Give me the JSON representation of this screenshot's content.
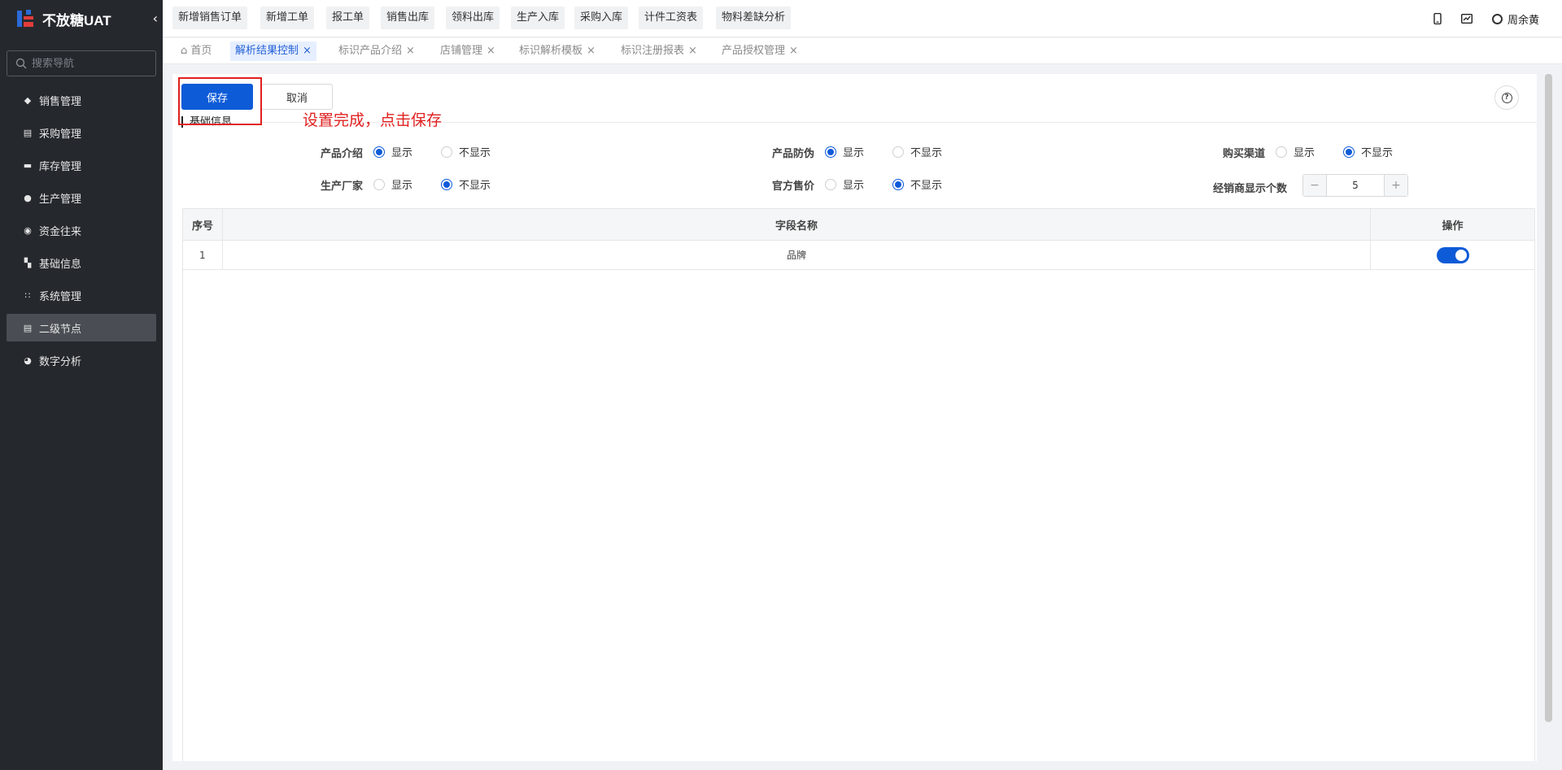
{
  "brand": {
    "title": "不放糖UAT"
  },
  "sidebar": {
    "search_placeholder": "搜索导航",
    "items": [
      {
        "label": "销售管理",
        "icon": "tag-icon"
      },
      {
        "label": "采购管理",
        "icon": "cart-icon"
      },
      {
        "label": "库存管理",
        "icon": "box-icon"
      },
      {
        "label": "生产管理",
        "icon": "production-icon"
      },
      {
        "label": "资金往来",
        "icon": "money-icon"
      },
      {
        "label": "基础信息",
        "icon": "info-icon"
      },
      {
        "label": "系统管理",
        "icon": "grid-icon"
      },
      {
        "label": "二级节点",
        "icon": "document-icon",
        "active": true
      },
      {
        "label": "数字分析",
        "icon": "pie-chart-icon"
      }
    ]
  },
  "quick_buttons": [
    "新增销售订单",
    "新增工单",
    "报工单",
    "销售出库",
    "领料出库",
    "生产入库",
    "采购入库",
    "计件工资表",
    "物料差缺分析"
  ],
  "user": {
    "name": "周余黄"
  },
  "tabs": [
    {
      "label": "首页"
    },
    {
      "label": "解析结果控制",
      "active": true
    },
    {
      "label": "标识产品介绍"
    },
    {
      "label": "店铺管理"
    },
    {
      "label": "标识解析模板"
    },
    {
      "label": "标识注册报表"
    },
    {
      "label": "产品授权管理"
    }
  ],
  "toolbar": {
    "save_label": "保存",
    "cancel_label": "取消",
    "help_label": "?"
  },
  "annotation": "设置完成，点击保存",
  "section_title": "基础信息",
  "fields": {
    "product_intro": {
      "label": "产品介绍",
      "show": "显示",
      "hide": "不显示",
      "value": "show"
    },
    "anti_fake": {
      "label": "产品防伪",
      "show": "显示",
      "hide": "不显示",
      "value": "show"
    },
    "channel": {
      "label": "购买渠道",
      "show": "显示",
      "hide": "不显示",
      "value": "hide"
    },
    "manufacturer": {
      "label": "生产厂家",
      "show": "显示",
      "hide": "不显示",
      "value": "hide"
    },
    "official_price": {
      "label": "官方售价",
      "show": "显示",
      "hide": "不显示",
      "value": "hide"
    },
    "dealer_count": {
      "label": "经销商显示个数",
      "value": "5",
      "minus": "−",
      "plus": "+"
    }
  },
  "table": {
    "headers": [
      "序号",
      "字段名称",
      "操作"
    ],
    "rows": [
      {
        "index": "1",
        "name": "品牌",
        "enabled": true
      }
    ]
  },
  "colors": {
    "primary": "#0e5bd8",
    "sidebar_bg": "#25292e",
    "annotation": "#e02020"
  }
}
